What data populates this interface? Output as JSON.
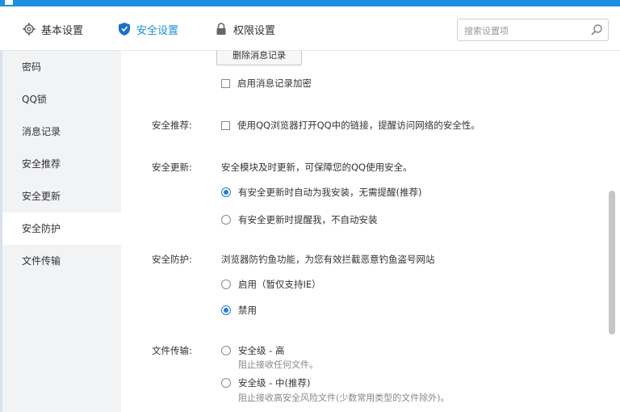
{
  "nav": {
    "tabs": [
      {
        "label": "基本设置",
        "icon": "gear-icon"
      },
      {
        "label": "安全设置",
        "icon": "shield-icon"
      },
      {
        "label": "权限设置",
        "icon": "lock-icon"
      }
    ],
    "active_tab": "安全设置",
    "search_placeholder": "搜索设置项"
  },
  "sidebar": {
    "items": [
      "密码",
      "QQ锁",
      "消息记录",
      "安全推荐",
      "安全更新",
      "安全防护",
      "文件传输"
    ],
    "active_item": "安全防护"
  },
  "content": {
    "delete_history_button": "删除消息记录",
    "enable_encryption": "启用消息记录加密",
    "recommend": {
      "label": "安全推荐:",
      "option": "使用QQ浏览器打开QQ中的链接，提醒访问网络的安全性。"
    },
    "update": {
      "label": "安全更新:",
      "description": "安全模块及时更新，可保障您的QQ使用安全。",
      "options": [
        "有安全更新时自动为我安装，无需提醒(推荐)",
        "有安全更新时提醒我，不自动安装"
      ],
      "selected": 0
    },
    "protection": {
      "label": "安全防护:",
      "description": "浏览器防钓鱼功能，为您有效拦截恶意钓鱼盗号网站",
      "options": [
        "启用（暂仅支持IE）",
        "禁用"
      ],
      "selected": 1
    },
    "file_transfer": {
      "label": "文件传输:",
      "options": [
        {
          "title": "安全级 - 高",
          "note": "阻止接收任何文件。"
        },
        {
          "title": "安全级 - 中(推荐)",
          "note": "阻止接收高安全风险文件(少数常用类型的文件除外)。"
        }
      ]
    }
  },
  "colors": {
    "accent": "#1c8fe0",
    "sidebar_bg": "#f2f3f5",
    "radio_selected": "#1f7ed6"
  }
}
